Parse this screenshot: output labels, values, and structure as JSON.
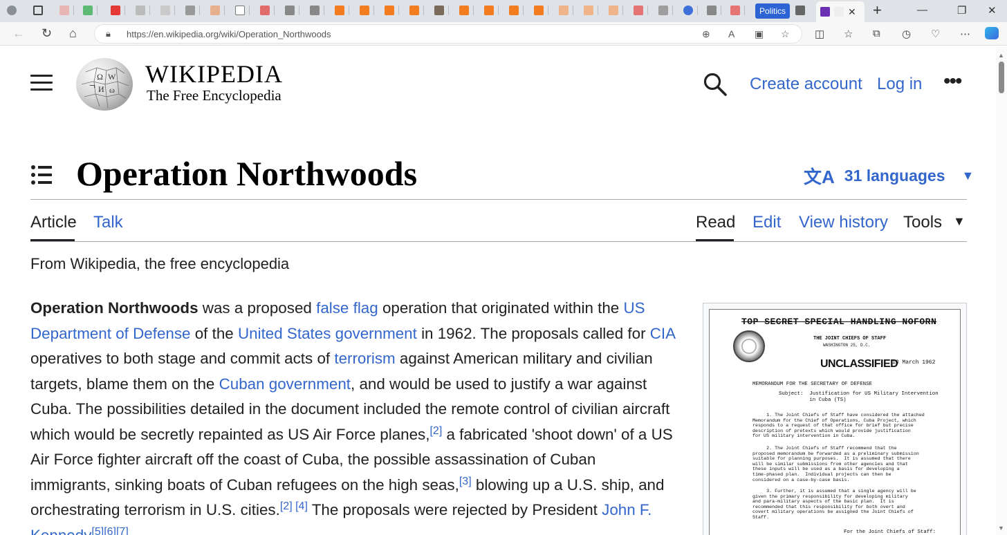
{
  "browser": {
    "tabs_label_politics": "Politics",
    "address": "https://en.wikipedia.org/wiki/Operation_Northwoods",
    "icons": [
      "back-icon",
      "refresh-icon",
      "home-icon",
      "lock-icon",
      "zoom-icon",
      "read-aloud-icon",
      "immersive-reader-icon",
      "favorite-icon",
      "split-screen-icon",
      "favorites-icon",
      "collections-icon",
      "history-icon",
      "performance-icon",
      "more-icon",
      "copilot-icon"
    ]
  },
  "wiki": {
    "wordmark": "WIKIPEDIA",
    "tagline": "The Free Encyclopedia",
    "create_account": "Create account",
    "log_in": "Log in",
    "more": "•••"
  },
  "page": {
    "title": "Operation Northwoods",
    "languages": "31 languages",
    "tabs": {
      "article": "Article",
      "talk": "Talk",
      "read": "Read",
      "edit": "Edit",
      "view_history": "View history",
      "tools": "Tools"
    },
    "from": "From Wikipedia, the free encyclopedia"
  },
  "article": {
    "s1_bold": "Operation Northwoods",
    "s1a": " was a proposed ",
    "link_false_flag": "false flag",
    "s1b": " operation that originated within the ",
    "link_dod": "US Department of Defense",
    "s1c": " of the ",
    "link_usgov": "United States government",
    "s1d": " in 1962. The proposals called for ",
    "link_cia": "CIA",
    "s1e": " operatives to both stage and commit acts of ",
    "link_terrorism": "terrorism",
    "s1f": " against American military and civilian targets, blame them on the ",
    "link_cuban_gov": "Cuban government",
    "s1g": ", and would be used to justify a war against Cuba. The possibilities detailed in the document included the remote control of civilian aircraft which would be secretly repainted as US Air Force planes,",
    "ref2a": "[2]",
    "s1h": " a fabricated 'shoot down' of a US Air Force fighter aircraft off the coast of Cuba, the possible assassination of Cuban immigrants, sinking boats of Cuban refugees on the high seas,",
    "ref3": "[3]",
    "s1i": " blowing up a U.S. ship, and orchestrating terrorism in U.S. cities.",
    "ref2b": "[2]",
    "ref4": "[4]",
    "s1j": " The proposals were rejected by President ",
    "link_jfk": "John F. Kennedy",
    "ref567": "[5][6][7]"
  },
  "memo": {
    "banner": "TOP SECRET SPECIAL HANDLING NOFORN",
    "jcs": "THE JOINT CHIEFS OF STAFF",
    "jcs_city": "WASHINGTON 25, D.C.",
    "stamp": "UNCLASSIFIED",
    "date": "13 March 1962",
    "to": "MEMORANDUM FOR THE SECRETARY OF DEFENSE",
    "subject": "Subject:  Justification for US Military Intervention\n          in Cuba (TS)",
    "p1": "     1. The Joint Chiefs of Staff have considered the attached\nMemorandum for the Chief of Operations, Cuba Project, which\nresponds to a request of that office for brief but precise\ndescription of pretexts which would provide justification\nfor US military intervention in Cuba.",
    "p2": "     2. The Joint Chiefs of Staff recommend that the\nproposed memorandum be forwarded as a preliminary submission\nsuitable for planning purposes.  It is assumed that there\nwill be similar submissions from other agencies and that\nthese inputs will be used as a basis for developing a\ntime-phased plan.  Individual projects can then be\nconsidered on a case-by-case basis.",
    "p3": "     3. Further, it is assumed that a single agency will be\ngiven the primary responsibility for developing military\nand para-military aspects of the basic plan.  It is\nrecommended that this responsibility for both overt and\ncovert military operations be assigned the Joint Chiefs of\nStaff.",
    "sig": "For the Joint Chiefs of Staff:"
  }
}
